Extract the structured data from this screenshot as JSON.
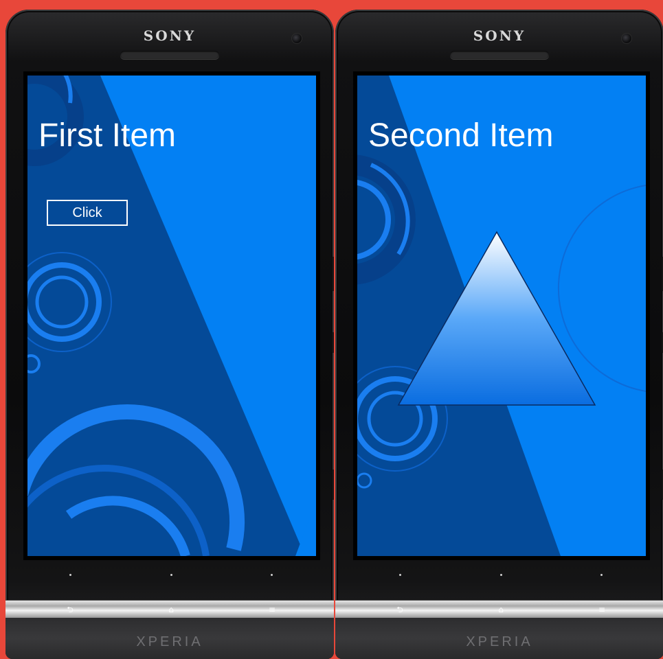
{
  "phones": [
    {
      "brand": "SONY",
      "model": "XPERIA",
      "screen": {
        "title": "First Item",
        "button_label": "Click"
      }
    },
    {
      "brand": "SONY",
      "model": "XPERIA",
      "screen": {
        "title": "Second Item"
      }
    }
  ],
  "icons": {
    "back": "back-arrow-icon",
    "home": "home-icon",
    "menu": "menu-icon"
  },
  "colors": {
    "background": "#e8473a",
    "screen_light_blue": "#0380f3",
    "screen_dark_blue": "#044a98",
    "ring_blue": "#1a7ef0",
    "text": "#ffffff"
  }
}
